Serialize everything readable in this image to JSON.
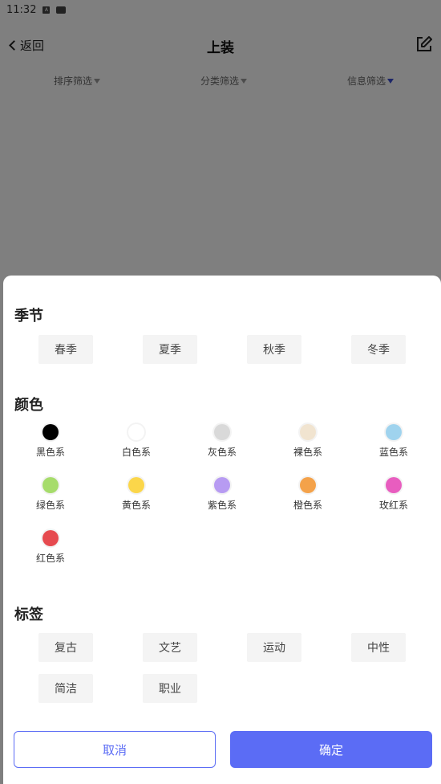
{
  "status_bar": {
    "time": "11:32",
    "icon_a_label": "A"
  },
  "nav": {
    "back_label": "返回",
    "title": "上装"
  },
  "filters": [
    {
      "label": "排序筛选"
    },
    {
      "label": "分类筛选"
    },
    {
      "label": "信息筛选"
    }
  ],
  "sheet": {
    "season": {
      "title": "季节",
      "options": [
        "春季",
        "夏季",
        "秋季",
        "冬季"
      ]
    },
    "color": {
      "title": "颜色",
      "options": [
        {
          "label": "黑色系",
          "color": "#000000"
        },
        {
          "label": "白色系",
          "color": "#ffffff"
        },
        {
          "label": "灰色系",
          "color": "#d9d9d9"
        },
        {
          "label": "裸色系",
          "color": "#f1e4d0"
        },
        {
          "label": "蓝色系",
          "color": "#9fd3ee"
        },
        {
          "label": "绿色系",
          "color": "#a6dc6b"
        },
        {
          "label": "黄色系",
          "color": "#fbd64a"
        },
        {
          "label": "紫色系",
          "color": "#b79bf2"
        },
        {
          "label": "橙色系",
          "color": "#f4a24a"
        },
        {
          "label": "玫红系",
          "color": "#e85dbf"
        },
        {
          "label": "红色系",
          "color": "#e64a4f"
        }
      ]
    },
    "tags": {
      "title": "标签",
      "options": [
        "复古",
        "文艺",
        "运动",
        "中性",
        "简洁",
        "职业"
      ]
    },
    "cancel_label": "取消",
    "confirm_label": "确定"
  },
  "colors": {
    "accent": "#5b6cf5",
    "filter_active": "#3b4cd1"
  }
}
